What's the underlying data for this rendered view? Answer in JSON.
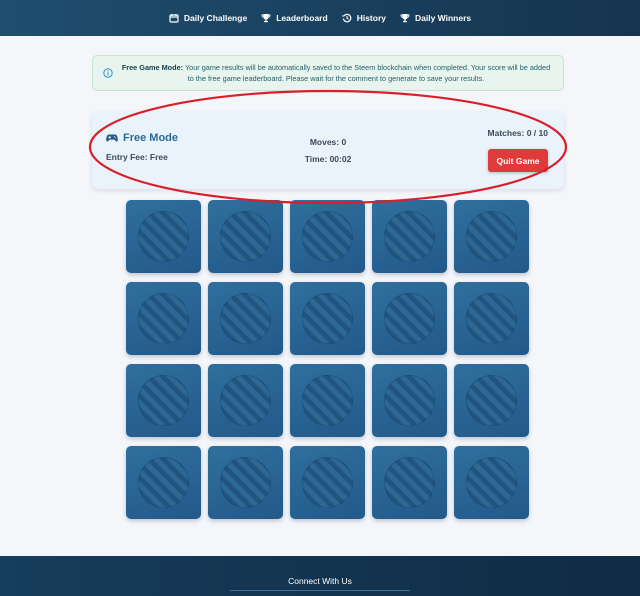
{
  "nav": {
    "items": [
      {
        "label": "Daily Challenge",
        "icon": "calendar-icon"
      },
      {
        "label": "Leaderboard",
        "icon": "trophy-icon"
      },
      {
        "label": "History",
        "icon": "history-icon"
      },
      {
        "label": "Daily Winners",
        "icon": "trophy-icon"
      }
    ]
  },
  "info_banner": {
    "icon": "info-icon",
    "title": "Free Game Mode:",
    "text": " Your game results will be automatically saved to the Steem blockchain when completed. Your score will be added to the free game leaderboard. Please wait for the comment to generate to save your results."
  },
  "status": {
    "mode_icon": "gamepad-icon",
    "mode_label": "Free Mode",
    "entry_fee": "Entry Fee: Free",
    "moves": "Moves: 0",
    "time": "Time: 00:02",
    "matches": "Matches: 0 / 10",
    "quit_label": "Quit Game"
  },
  "board": {
    "rows": 4,
    "cols": 5,
    "face_down_cards": 20
  },
  "footer": {
    "title": "Connect With Us"
  },
  "colors": {
    "nav_bg": "#1f4e6f",
    "accent": "#2a6b95",
    "card": "#2a6495",
    "quit_button": "#e03b3b",
    "annotation": "#d9202a",
    "info_bg": "#e8f5ee"
  }
}
